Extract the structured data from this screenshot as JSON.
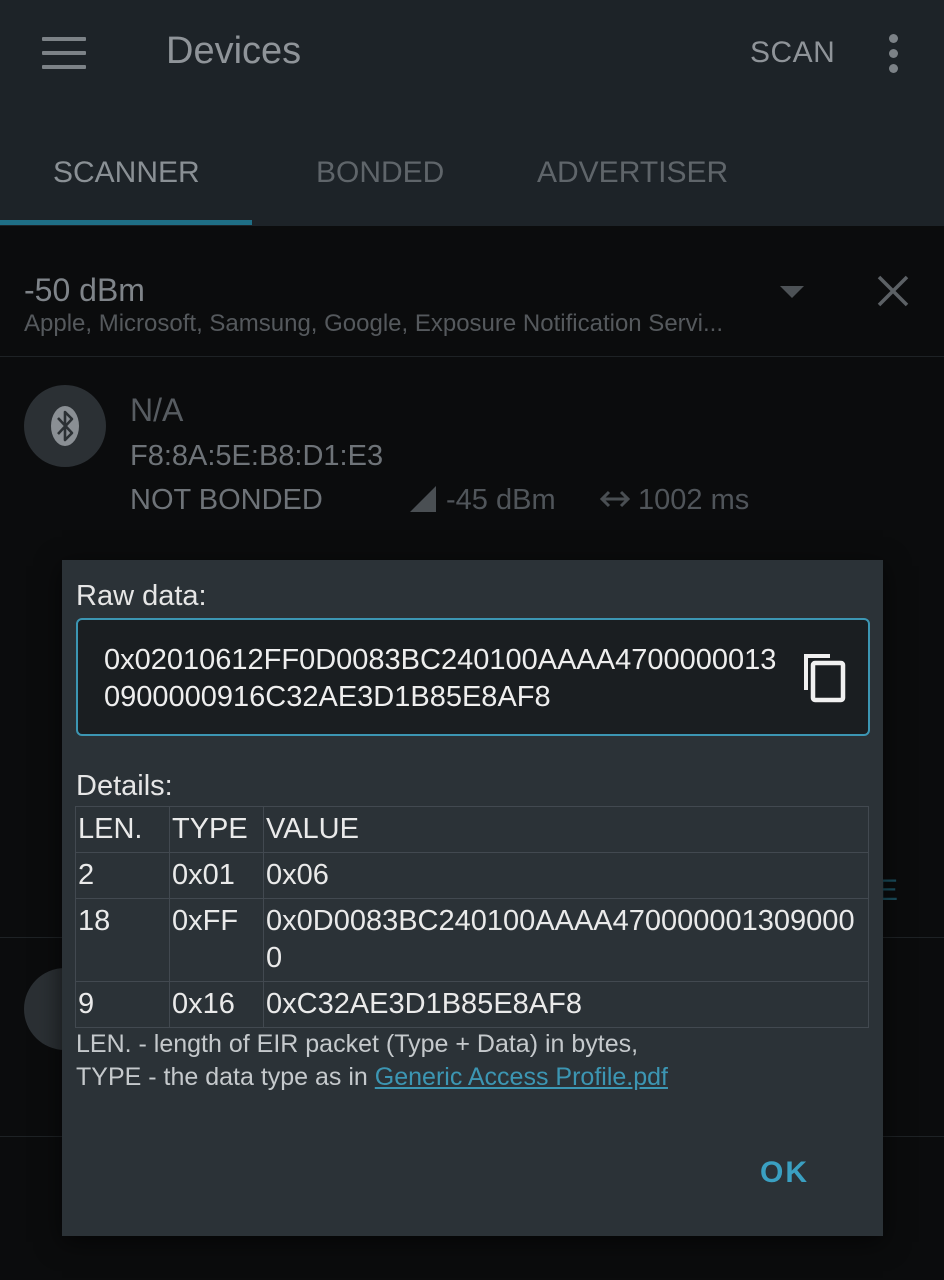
{
  "appbar": {
    "title": "Devices",
    "scan_label": "SCAN",
    "menu_icon": "hamburger-menu-icon",
    "more_icon": "more-vertical-icon"
  },
  "tabs": [
    {
      "label": "SCANNER",
      "active": true
    },
    {
      "label": "BONDED",
      "active": false
    },
    {
      "label": "ADVERTISER",
      "active": false
    }
  ],
  "filter": {
    "title": "-50 dBm",
    "subtitle": "Apple, Microsoft, Samsung, Google, Exposure Notification Servi..."
  },
  "device": {
    "name": "N/A",
    "mac": "F8:8A:5E:B8:D1:E3",
    "bond_state": "NOT BONDED",
    "rssi": "-45 dBm",
    "interval": "1002 ms"
  },
  "background_partial_text": "E",
  "dialog": {
    "raw_label": "Raw data:",
    "raw_value": "0x02010612FF0D0083BC240100AAAA47000000130900000916C32AE3D1B85E8AF8",
    "details_label": "Details:",
    "columns": [
      "LEN.",
      "TYPE",
      "VALUE"
    ],
    "rows": [
      {
        "len": "2",
        "type": "0x01",
        "value": "0x06"
      },
      {
        "len": "18",
        "type": "0xFF",
        "value": "0x0D0083BC240100AAAA4700000013090000"
      },
      {
        "len": "9",
        "type": "0x16",
        "value": "0xC32AE3D1B85E8AF8"
      }
    ],
    "legend_line1": "LEN. - length of EIR packet (Type + Data) in bytes,",
    "legend_line2_prefix": "TYPE - the data type as in ",
    "legend_link": "Generic Access Profile.pdf",
    "ok_label": "OK"
  },
  "colors": {
    "accent": "#3c96b3",
    "appbar_bg": "#1d2328",
    "dialog_bg": "#2b3237",
    "page_bg": "#0b0c0d"
  }
}
